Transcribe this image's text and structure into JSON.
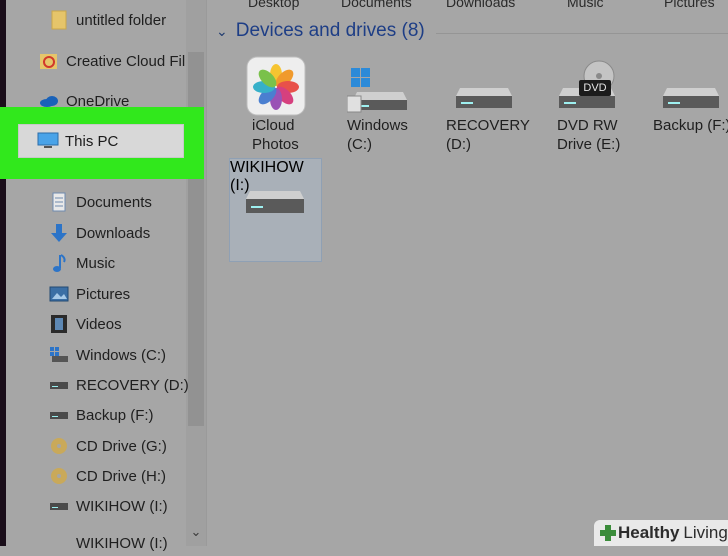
{
  "top_labels": [
    "Desktop",
    "Documents",
    "Downloads",
    "Music",
    "Pictures"
  ],
  "sidebar": {
    "items": [
      {
        "label": "untitled folder",
        "icon": "folder-icon"
      },
      {
        "label": "Creative Cloud Fil",
        "icon": "creative-cloud-icon"
      },
      {
        "label": "OneDrive",
        "icon": "onedrive-icon"
      },
      {
        "label": "This PC",
        "icon": "this-pc-icon"
      },
      {
        "label": "Documents",
        "icon": "documents-icon"
      },
      {
        "label": "Downloads",
        "icon": "downloads-icon"
      },
      {
        "label": "Music",
        "icon": "music-icon"
      },
      {
        "label": "Pictures",
        "icon": "pictures-icon"
      },
      {
        "label": "Videos",
        "icon": "videos-icon"
      },
      {
        "label": "Windows (C:)",
        "icon": "windows-drive-icon"
      },
      {
        "label": "RECOVERY (D:)",
        "icon": "drive-icon"
      },
      {
        "label": "Backup (F:)",
        "icon": "drive-icon"
      },
      {
        "label": "CD Drive (G:)",
        "icon": "cd-drive-icon"
      },
      {
        "label": "CD Drive (H:)",
        "icon": "cd-drive-icon"
      },
      {
        "label": "WIKIHOW (I:)",
        "icon": "drive-icon"
      },
      {
        "label": "WIKIHOW (I:)",
        "icon": "drive-icon"
      }
    ]
  },
  "devices": {
    "header": "Devices and drives (8)",
    "tiles": [
      {
        "line1": "iCloud",
        "line2": "Photos"
      },
      {
        "line1": "Windows",
        "line2": "(C:)"
      },
      {
        "line1": "RECOVERY",
        "line2": "(D:)"
      },
      {
        "line1": "DVD RW",
        "line2": "Drive (E:)"
      },
      {
        "line1": "Backup (F:)",
        "line2": ""
      },
      {
        "line1": "WIKIHOW",
        "line2": "(I:)"
      }
    ],
    "dvd_badge": "DVD"
  },
  "watermark": {
    "part1": "Healthy",
    "part2": "Living"
  },
  "colors": {
    "background": "#a6a6a6",
    "highlight": "#31e81c",
    "header_text": "#1e3e86"
  }
}
